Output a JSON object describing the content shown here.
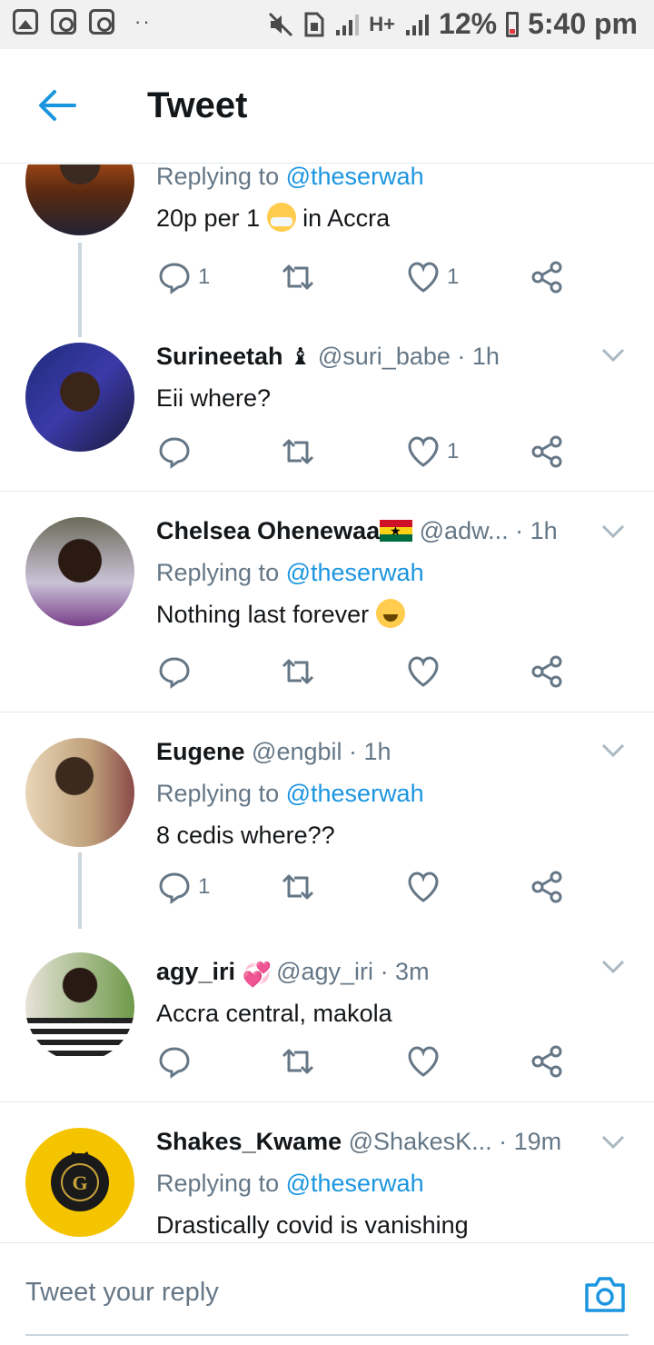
{
  "status_bar": {
    "left_icons": [
      "gallery-icon",
      "instagram-icon",
      "instagram-icon"
    ],
    "dots": "··",
    "network_label": "H+",
    "battery": "12%",
    "time": "5:40 pm"
  },
  "header": {
    "title": "Tweet"
  },
  "tweets": [
    {
      "name": "",
      "handle": "",
      "time": "",
      "replying_prefix": "Replying to",
      "replying_to": "@theserwah",
      "text_before": "20p per 1",
      "text_after": "in Accra",
      "emoji": "mask-emoji",
      "reply_count": "1",
      "like_count": "1"
    },
    {
      "name": "Surineetah",
      "handle": "@suri_babe",
      "time": "· 1h",
      "text": "Eii where?",
      "reply_count": "",
      "like_count": "1"
    },
    {
      "name": "Chelsea Ohenewaa",
      "handle": "@adw...",
      "time": "· 1h",
      "replying_prefix": "Replying to",
      "replying_to": "@theserwah",
      "text": "Nothing last forever",
      "emoji": "laugh-emoji",
      "reply_count": "",
      "like_count": ""
    },
    {
      "name": "Eugene",
      "handle": "@engbil",
      "time": "· 1h",
      "replying_prefix": "Replying to",
      "replying_to": "@theserwah",
      "text": "8 cedis where??",
      "reply_count": "1",
      "like_count": ""
    },
    {
      "name": "agy_iri",
      "handle": "@agy_iri",
      "time": "· 3m",
      "text": "Accra central, makola",
      "reply_count": "",
      "like_count": ""
    },
    {
      "name": "Shakes_Kwame",
      "handle": "@ShakesK...",
      "time": "· 19m",
      "replying_prefix": "Replying to",
      "replying_to": "@theserwah",
      "text": "Drastically covid is vanishing"
    }
  ],
  "reply_bar": {
    "placeholder": "Tweet your reply"
  },
  "colors": {
    "accent": "#1b95e0",
    "secondary_text": "#657786",
    "primary_text": "#14171a",
    "divider": "#e1e8ed"
  }
}
